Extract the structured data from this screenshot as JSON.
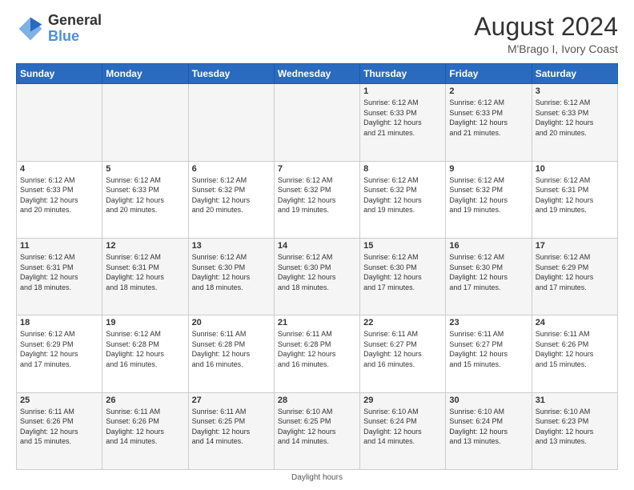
{
  "header": {
    "logo_line1": "General",
    "logo_line2": "Blue",
    "month_year": "August 2024",
    "location": "M'Brago I, Ivory Coast"
  },
  "footer": {
    "note": "Daylight hours"
  },
  "days_of_week": [
    "Sunday",
    "Monday",
    "Tuesday",
    "Wednesday",
    "Thursday",
    "Friday",
    "Saturday"
  ],
  "weeks": [
    [
      {
        "day": "",
        "info": ""
      },
      {
        "day": "",
        "info": ""
      },
      {
        "day": "",
        "info": ""
      },
      {
        "day": "",
        "info": ""
      },
      {
        "day": "1",
        "info": "Sunrise: 6:12 AM\nSunset: 6:33 PM\nDaylight: 12 hours\nand 21 minutes."
      },
      {
        "day": "2",
        "info": "Sunrise: 6:12 AM\nSunset: 6:33 PM\nDaylight: 12 hours\nand 21 minutes."
      },
      {
        "day": "3",
        "info": "Sunrise: 6:12 AM\nSunset: 6:33 PM\nDaylight: 12 hours\nand 20 minutes."
      }
    ],
    [
      {
        "day": "4",
        "info": "Sunrise: 6:12 AM\nSunset: 6:33 PM\nDaylight: 12 hours\nand 20 minutes."
      },
      {
        "day": "5",
        "info": "Sunrise: 6:12 AM\nSunset: 6:33 PM\nDaylight: 12 hours\nand 20 minutes."
      },
      {
        "day": "6",
        "info": "Sunrise: 6:12 AM\nSunset: 6:32 PM\nDaylight: 12 hours\nand 20 minutes."
      },
      {
        "day": "7",
        "info": "Sunrise: 6:12 AM\nSunset: 6:32 PM\nDaylight: 12 hours\nand 19 minutes."
      },
      {
        "day": "8",
        "info": "Sunrise: 6:12 AM\nSunset: 6:32 PM\nDaylight: 12 hours\nand 19 minutes."
      },
      {
        "day": "9",
        "info": "Sunrise: 6:12 AM\nSunset: 6:32 PM\nDaylight: 12 hours\nand 19 minutes."
      },
      {
        "day": "10",
        "info": "Sunrise: 6:12 AM\nSunset: 6:31 PM\nDaylight: 12 hours\nand 19 minutes."
      }
    ],
    [
      {
        "day": "11",
        "info": "Sunrise: 6:12 AM\nSunset: 6:31 PM\nDaylight: 12 hours\nand 18 minutes."
      },
      {
        "day": "12",
        "info": "Sunrise: 6:12 AM\nSunset: 6:31 PM\nDaylight: 12 hours\nand 18 minutes."
      },
      {
        "day": "13",
        "info": "Sunrise: 6:12 AM\nSunset: 6:30 PM\nDaylight: 12 hours\nand 18 minutes."
      },
      {
        "day": "14",
        "info": "Sunrise: 6:12 AM\nSunset: 6:30 PM\nDaylight: 12 hours\nand 18 minutes."
      },
      {
        "day": "15",
        "info": "Sunrise: 6:12 AM\nSunset: 6:30 PM\nDaylight: 12 hours\nand 17 minutes."
      },
      {
        "day": "16",
        "info": "Sunrise: 6:12 AM\nSunset: 6:30 PM\nDaylight: 12 hours\nand 17 minutes."
      },
      {
        "day": "17",
        "info": "Sunrise: 6:12 AM\nSunset: 6:29 PM\nDaylight: 12 hours\nand 17 minutes."
      }
    ],
    [
      {
        "day": "18",
        "info": "Sunrise: 6:12 AM\nSunset: 6:29 PM\nDaylight: 12 hours\nand 17 minutes."
      },
      {
        "day": "19",
        "info": "Sunrise: 6:12 AM\nSunset: 6:28 PM\nDaylight: 12 hours\nand 16 minutes."
      },
      {
        "day": "20",
        "info": "Sunrise: 6:11 AM\nSunset: 6:28 PM\nDaylight: 12 hours\nand 16 minutes."
      },
      {
        "day": "21",
        "info": "Sunrise: 6:11 AM\nSunset: 6:28 PM\nDaylight: 12 hours\nand 16 minutes."
      },
      {
        "day": "22",
        "info": "Sunrise: 6:11 AM\nSunset: 6:27 PM\nDaylight: 12 hours\nand 16 minutes."
      },
      {
        "day": "23",
        "info": "Sunrise: 6:11 AM\nSunset: 6:27 PM\nDaylight: 12 hours\nand 15 minutes."
      },
      {
        "day": "24",
        "info": "Sunrise: 6:11 AM\nSunset: 6:26 PM\nDaylight: 12 hours\nand 15 minutes."
      }
    ],
    [
      {
        "day": "25",
        "info": "Sunrise: 6:11 AM\nSunset: 6:26 PM\nDaylight: 12 hours\nand 15 minutes."
      },
      {
        "day": "26",
        "info": "Sunrise: 6:11 AM\nSunset: 6:26 PM\nDaylight: 12 hours\nand 14 minutes."
      },
      {
        "day": "27",
        "info": "Sunrise: 6:11 AM\nSunset: 6:25 PM\nDaylight: 12 hours\nand 14 minutes."
      },
      {
        "day": "28",
        "info": "Sunrise: 6:10 AM\nSunset: 6:25 PM\nDaylight: 12 hours\nand 14 minutes."
      },
      {
        "day": "29",
        "info": "Sunrise: 6:10 AM\nSunset: 6:24 PM\nDaylight: 12 hours\nand 14 minutes."
      },
      {
        "day": "30",
        "info": "Sunrise: 6:10 AM\nSunset: 6:24 PM\nDaylight: 12 hours\nand 13 minutes."
      },
      {
        "day": "31",
        "info": "Sunrise: 6:10 AM\nSunset: 6:23 PM\nDaylight: 12 hours\nand 13 minutes."
      }
    ]
  ]
}
